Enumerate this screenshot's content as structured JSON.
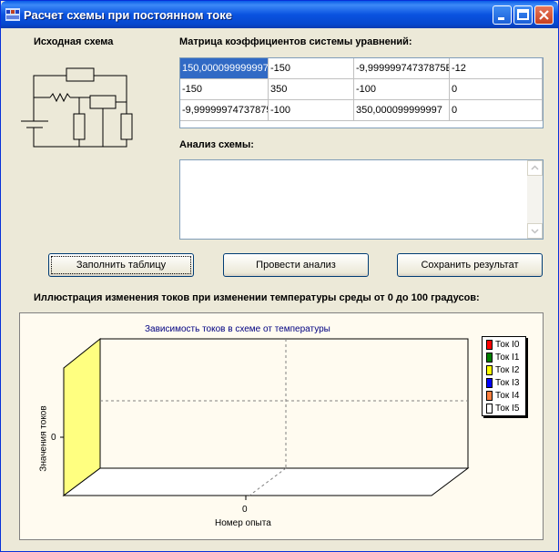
{
  "window": {
    "title": "Расчет схемы при постоянном токе"
  },
  "labels": {
    "source_circuit": "Исходная схема",
    "matrix": "Матрица коэффициентов системы уравнений:",
    "analysis": "Анализ схемы:",
    "illustration": "Иллюстрация изменения токов при изменении температуры среды от 0 до 100 градусов:"
  },
  "matrix": {
    "rows": [
      [
        "150,000099999997",
        "-150",
        "-9,99999974737875E",
        "-12"
      ],
      [
        "-150",
        "350",
        "-100",
        "0"
      ],
      [
        "-9,99999974737875",
        "-100",
        "350,000099999997",
        "0"
      ]
    ]
  },
  "analysis_text": "",
  "buttons": {
    "fill": "Заполнить таблицу",
    "analyze": "Провести анализ",
    "save": "Сохранить результат"
  },
  "chart_data": {
    "type": "area",
    "title": "Зависимость токов в схеме от температуры",
    "xlabel": "Номер опыта",
    "ylabel": "Значения токов",
    "x_ticks": [
      "0"
    ],
    "y_ticks": [
      "0"
    ],
    "series": [
      {
        "name": "Ток I0",
        "color": "#ff0000"
      },
      {
        "name": "Ток I1",
        "color": "#008000"
      },
      {
        "name": "Ток I2",
        "color": "#ffff00"
      },
      {
        "name": "Ток I3",
        "color": "#0000ff"
      },
      {
        "name": "Ток I4",
        "color": "#ff8040"
      },
      {
        "name": "Ток I5",
        "color": "#ffffff"
      }
    ],
    "legend_position": "top-right",
    "grid": true
  }
}
